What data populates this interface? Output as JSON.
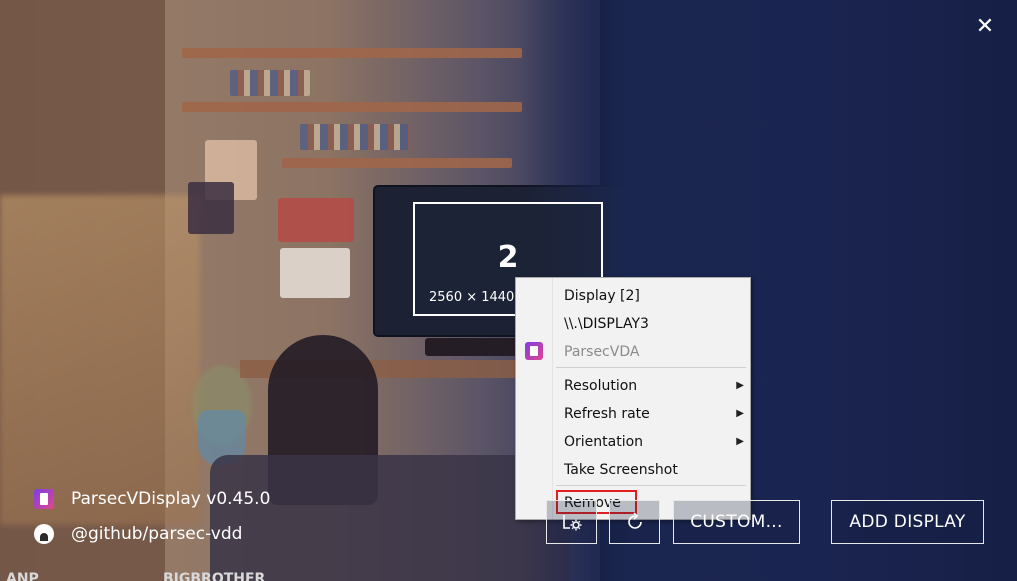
{
  "window": {
    "close_glyph": "✕"
  },
  "display_tile": {
    "number": "2",
    "resolution": "2560 × 1440"
  },
  "context_menu": {
    "header_items": [
      {
        "label": "Display [2]",
        "disabled": false
      },
      {
        "label": "\\\\.\\DISPLAY3",
        "disabled": false
      },
      {
        "label": "ParsecVDA",
        "disabled": true,
        "icon": "parsec-icon"
      }
    ],
    "submenus": [
      {
        "label": "Resolution",
        "has_submenu": true
      },
      {
        "label": "Refresh rate",
        "has_submenu": true
      },
      {
        "label": "Orientation",
        "has_submenu": true
      },
      {
        "label": "Take Screenshot",
        "has_submenu": false
      }
    ],
    "remove_label": "Remove",
    "remove_highlight_color": "#e02020"
  },
  "app_info": {
    "title": "ParsecVDisplay v0.45.0",
    "github": "@github/parsec-vdd"
  },
  "buttons": {
    "custom": "CUSTOM...",
    "add_display": "ADD DISPLAY"
  },
  "taskbar_tabs": [
    "ANP",
    "BIGBROTHER"
  ],
  "colors": {
    "accent": "#ffffff",
    "menu_bg": "#f2f2f2",
    "app_icon_gradient": [
      "#7b3fe4",
      "#e2468e"
    ]
  }
}
